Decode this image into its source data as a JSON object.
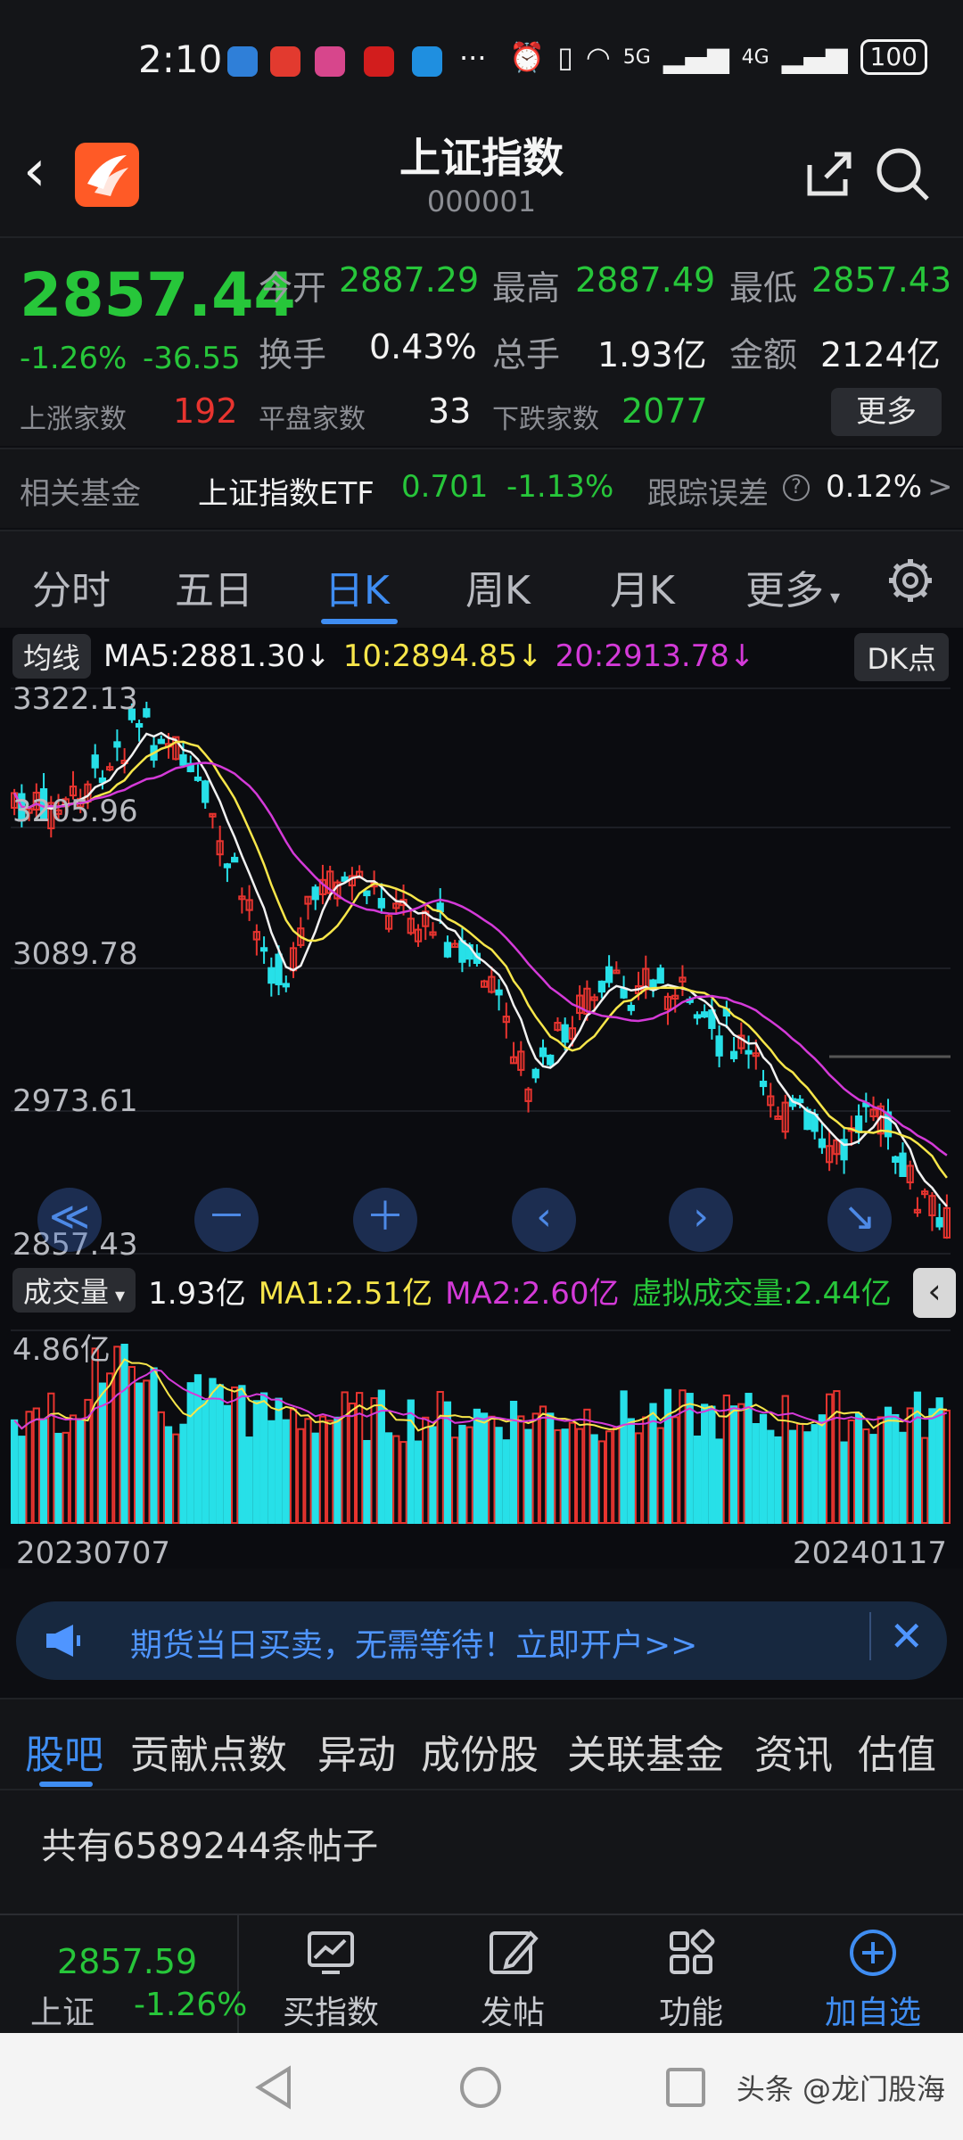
{
  "status_bar": {
    "time": "2:10",
    "more": "···",
    "net_5g": "5G",
    "net_4g": "4G",
    "battery": "100",
    "app_icon_colors": [
      "#2f7fd8",
      "#e23a2f",
      "#d7468c",
      "#d21d1d",
      "#1f8fe0"
    ]
  },
  "header": {
    "title": "上证指数",
    "code": "000001",
    "back_icon": "chevron-left-icon",
    "share_icon": "share-icon",
    "search_icon": "search-icon"
  },
  "quote": {
    "price": "2857.44",
    "change_pct": "-1.26%",
    "change": "-36.55",
    "open_label": "今开",
    "open": "2887.29",
    "high_label": "最高",
    "high": "2887.49",
    "low_label": "最低",
    "low": "2857.43",
    "turnover_label": "换手",
    "turnover": "0.43%",
    "volume_label": "总手",
    "volume": "1.93亿",
    "amount_label": "金额",
    "amount": "2124亿",
    "up_label": "上涨家数",
    "up_count": "192",
    "flat_label": "平盘家数",
    "flat_count": "33",
    "down_label": "下跌家数",
    "down_count": "2077",
    "more_button": "更多"
  },
  "fund": {
    "label": "相关基金",
    "name": "上证指数ETF",
    "price": "0.701",
    "change": "-1.13%",
    "tracking_label": "跟踪误差",
    "tracking_value": "0.12%",
    "help_icon": "?",
    "arrow": ">"
  },
  "tabs": [
    "分时",
    "五日",
    "日K",
    "周K",
    "月K",
    "更多"
  ],
  "active_tab": 2,
  "chart": {
    "indicator_button": "均线",
    "ma5": "MA5:2881.30",
    "ma10": "10:2894.85",
    "ma20": "20:2913.78",
    "ma_arrow": "↓",
    "dk_button": "DK点",
    "y_labels": [
      "3322.13",
      "3205.96",
      "3089.78",
      "2973.61",
      "2857.43"
    ],
    "controls": [
      "≪",
      "－",
      "＋",
      "‹",
      "›",
      "↘"
    ],
    "volume_button": "成交量",
    "volume_value": "1.93亿",
    "vol_ma1": "MA1:2.51亿",
    "vol_ma2": "MA2:2.60亿",
    "virtual_volume": "虚拟成交量:2.44亿",
    "volume_max": "4.86亿",
    "date_start": "20230707",
    "date_end": "20240117",
    "collapse_button": "‹",
    "colors": {
      "up": "#e8342f",
      "down": "#27e0e8",
      "ma5": "#f2f2f2",
      "ma10": "#f7e64a",
      "ma20": "#d43ad8"
    }
  },
  "chart_data": {
    "type": "candlestick",
    "x_range": [
      "20230707",
      "20240117"
    ],
    "ylim": [
      2857.43,
      3322.13
    ],
    "y_ticks": [
      3322.13,
      3205.96,
      3089.78,
      2973.61,
      2857.43
    ],
    "series": [
      {
        "name": "MA5",
        "values": [
          2881.3
        ]
      },
      {
        "name": "MA10",
        "values": [
          2894.85
        ]
      },
      {
        "name": "MA20",
        "values": [
          2913.78
        ]
      }
    ],
    "volume": {
      "max": "4.86亿",
      "last": "1.93亿",
      "MA1": "2.51亿",
      "MA2": "2.60亿"
    }
  },
  "banner": {
    "text": "期货当日买卖，无需等待！立即开户>>",
    "icon": "megaphone-icon",
    "close": "✕"
  },
  "sub_tabs": [
    "股吧",
    "贡献点数",
    "异动",
    "成份股",
    "关联基金",
    "资讯",
    "估值"
  ],
  "posts": {
    "count_text": "共有6589244条帖子"
  },
  "bottom_bar": {
    "price": "2857.59",
    "name": "上证",
    "change_pct": "-1.26%",
    "items": [
      {
        "label": "买指数",
        "icon": "chart-icon"
      },
      {
        "label": "发帖",
        "icon": "edit-icon"
      },
      {
        "label": "功能",
        "icon": "grid-icon"
      },
      {
        "label": "加自选",
        "icon": "plus-circle-icon"
      }
    ]
  },
  "watermark": "头条 @龙门股海"
}
